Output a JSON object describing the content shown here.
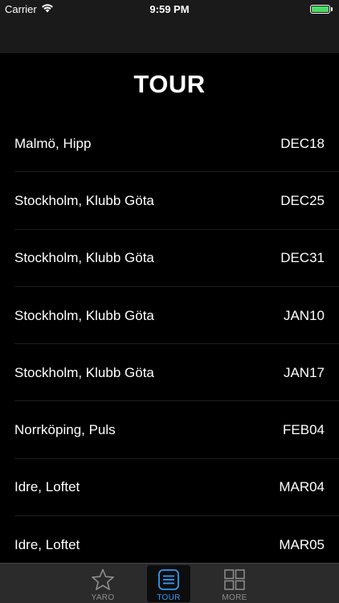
{
  "status_bar": {
    "carrier": "Carrier",
    "time": "9:59 PM",
    "battery_level": 1.0
  },
  "page": {
    "title": "TOUR"
  },
  "tour": {
    "dates": [
      {
        "venue": "Malmö, Hipp",
        "date": "DEC18"
      },
      {
        "venue": "Stockholm, Klubb Göta",
        "date": "DEC25"
      },
      {
        "venue": "Stockholm, Klubb Göta",
        "date": "DEC31"
      },
      {
        "venue": "Stockholm, Klubb Göta",
        "date": "JAN10"
      },
      {
        "venue": "Stockholm, Klubb Göta",
        "date": "JAN17"
      },
      {
        "venue": "Norrköping, Puls",
        "date": "FEB04"
      },
      {
        "venue": "Idre, Loftet",
        "date": "MAR04"
      },
      {
        "venue": "Idre, Loftet",
        "date": "MAR05"
      }
    ]
  },
  "tab_bar": {
    "tabs": [
      {
        "label": "YARO",
        "icon": "star-icon",
        "selected": false
      },
      {
        "label": "TOUR",
        "icon": "list-icon",
        "selected": true
      },
      {
        "label": "MORE",
        "icon": "grid-icon",
        "selected": false
      }
    ]
  },
  "colors": {
    "background": "#000000",
    "bar_background": "#1a1a1a",
    "tab_active": "#2f9cf4",
    "tab_inactive": "#8e8e8e",
    "battery": "#4cd964"
  }
}
